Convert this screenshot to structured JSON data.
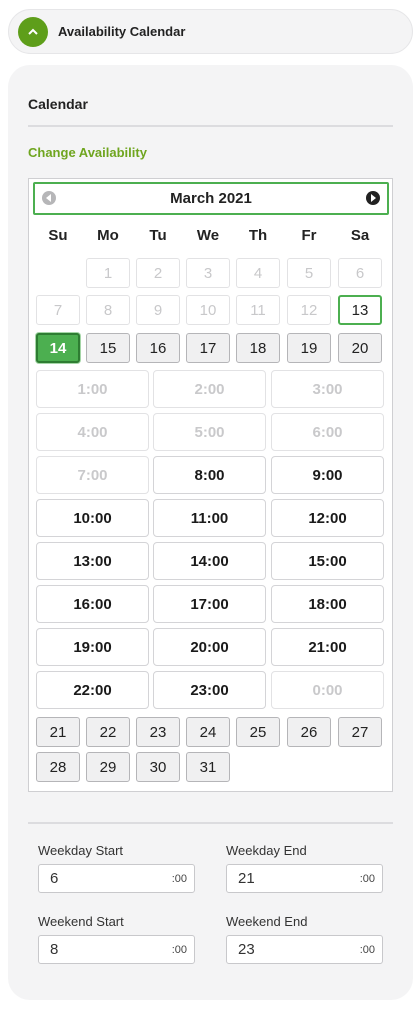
{
  "header": {
    "title": "Availability Calendar",
    "toggle_icon": "chevron-up-icon",
    "accent": "#5e9e1a"
  },
  "panel": {
    "title": "Calendar",
    "change_link": "Change Availability"
  },
  "calendar": {
    "month_label": "March 2021",
    "weekdays": [
      "Su",
      "Mo",
      "Tu",
      "We",
      "Th",
      "Fr",
      "Sa"
    ],
    "selected_day": "14",
    "today_day": "13",
    "days_before": [
      [
        "",
        "1",
        "2",
        "3",
        "4",
        "5",
        "6"
      ],
      [
        "7",
        "8",
        "9",
        "10",
        "11",
        "12",
        "13"
      ],
      [
        "14",
        "15",
        "16",
        "17",
        "18",
        "19",
        "20"
      ]
    ],
    "time_slots": [
      {
        "label": "1:00",
        "available": false
      },
      {
        "label": "2:00",
        "available": false
      },
      {
        "label": "3:00",
        "available": false
      },
      {
        "label": "4:00",
        "available": false
      },
      {
        "label": "5:00",
        "available": false
      },
      {
        "label": "6:00",
        "available": false
      },
      {
        "label": "7:00",
        "available": false
      },
      {
        "label": "8:00",
        "available": true
      },
      {
        "label": "9:00",
        "available": true
      },
      {
        "label": "10:00",
        "available": true
      },
      {
        "label": "11:00",
        "available": true
      },
      {
        "label": "12:00",
        "available": true
      },
      {
        "label": "13:00",
        "available": true
      },
      {
        "label": "14:00",
        "available": true
      },
      {
        "label": "15:00",
        "available": true
      },
      {
        "label": "16:00",
        "available": true
      },
      {
        "label": "17:00",
        "available": true
      },
      {
        "label": "18:00",
        "available": true
      },
      {
        "label": "19:00",
        "available": true
      },
      {
        "label": "20:00",
        "available": true
      },
      {
        "label": "21:00",
        "available": true
      },
      {
        "label": "22:00",
        "available": true
      },
      {
        "label": "23:00",
        "available": true
      },
      {
        "label": "0:00",
        "available": false
      }
    ],
    "days_after": [
      [
        "21",
        "22",
        "23",
        "24",
        "25",
        "26",
        "27"
      ],
      [
        "28",
        "29",
        "30",
        "31"
      ]
    ]
  },
  "settings": {
    "weekday_start": {
      "label": "Weekday Start",
      "value": "6",
      "suffix": ":00"
    },
    "weekday_end": {
      "label": "Weekday End",
      "value": "21",
      "suffix": ":00"
    },
    "weekend_start": {
      "label": "Weekend Start",
      "value": "8",
      "suffix": ":00"
    },
    "weekend_end": {
      "label": "Weekend End",
      "value": "23",
      "suffix": ":00"
    }
  }
}
